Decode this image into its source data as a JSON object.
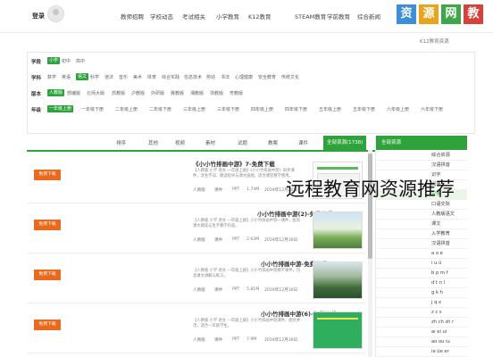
{
  "header": {
    "login": "登录",
    "nav": [
      "教师招聘",
      "学校动态",
      "考试相关",
      "小学教育",
      "K12教育",
      "STEAM教育",
      "学前教育",
      "综合新闻"
    ],
    "brand_chars": [
      "资",
      "源",
      "网",
      "教"
    ],
    "brand_colors": [
      "#3a8fd6",
      "#e9a41c",
      "#3fa74a",
      "#d8413b"
    ]
  },
  "breadcrumb": "K12教育资源",
  "filters": {
    "rows": [
      {
        "label": "学段",
        "items": [
          "小学",
          "初中",
          "高中"
        ],
        "active": 0
      },
      {
        "label": "学科",
        "items": [
          "数学",
          "英语",
          "语文",
          "科学",
          "道法",
          "音乐",
          "美术",
          "体育",
          "综合实践",
          "信息技术",
          "劳动",
          "书法",
          "心理健康",
          "安全教育",
          "传统文化"
        ],
        "active": 2
      },
      {
        "label": "版本",
        "items": [
          "人教版",
          "部编版",
          "北师大版",
          "苏教版",
          "沪教版",
          "外研版",
          "冀教版",
          "湘教版",
          "浙教版",
          "粤教版"
        ],
        "active": 0
      },
      {
        "label": "年级",
        "items": [
          "一年级上册",
          "一年级下册",
          "二年级上册",
          "二年级下册",
          "三年级上册",
          "三年级下册",
          "四年级上册",
          "四年级下册",
          "五年级上册",
          "五年级下册",
          "六年级上册",
          "六年级下册"
        ],
        "active": 0
      }
    ]
  },
  "tabs": [
    "全部资源(1738)",
    "课件",
    "教案",
    "试题",
    "素材",
    "视频",
    "其他",
    "排序"
  ],
  "results": [
    {
      "title": "《小小竹排画中游》7-免费下载",
      "desc": "【人教版 小学 语文 一年级上册】《小小竹排画中游》同步课件，含生字词、朗读指导与课文插图，适合课堂教学使用。",
      "meta": [
        "人教版",
        "课件",
        "PPT",
        "1.74M",
        "2019年12月30日"
      ],
      "download": "免费下载"
    },
    {
      "title": "小小竹排画中游(2)-免费下载",
      "desc": "【人教版 小学 语文 一年级上册】小小竹排画中游一课件，配有课文朗读与生字教学内容。",
      "meta": [
        "人教版",
        "课件",
        "PPT",
        "2.63M",
        "2019年12月30日"
      ],
      "download": "免费下载"
    },
    {
      "title": "小小竹排画中游-免费下载",
      "desc": "【人教版 小学 语文 一年级上册】小小竹排画中游教学课件，包含课文讲解与练习。",
      "meta": [
        "人教版",
        "课件",
        "PPT",
        "5.81M",
        "2019年12月30日"
      ],
      "download": "免费下载"
    },
    {
      "title": "小小竹排画中游(6)-免费下载",
      "desc": "【人教版 小学 语文 一年级上册】小小竹排画中游课件，图文并茂，适合一年级学生。",
      "meta": [
        "人教版",
        "课件",
        "PPT",
        "7.9M",
        "2019年12月30日"
      ],
      "download": "免费下载"
    }
  ],
  "sidebar": {
    "title": "全部资源",
    "items": [
      "综合资源",
      "汉语拼音",
      "识字",
      "阅读",
      "写字",
      "口语交际",
      "人教版语文",
      "课文",
      "入学教育",
      "汉语拼音",
      "a o e",
      "i u ü",
      "b p m f",
      "d t n l",
      "g k h",
      "j q x",
      "z c s",
      "zh ch sh r",
      "ai ei ui",
      "ao ou iu",
      "ie üe er"
    ],
    "selected": 4
  },
  "watermark": "远程教育网资源推荐"
}
